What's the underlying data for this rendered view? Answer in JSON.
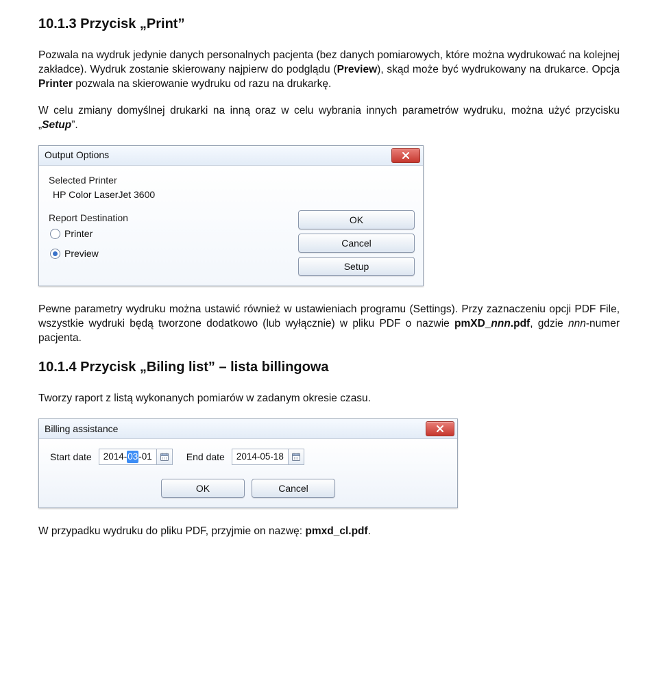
{
  "section1": {
    "heading": "10.1.3 Przycisk „Print”",
    "para1_runs": [
      {
        "text": "Pozwala na wydruk jedynie danych personalnych pacjenta (bez danych pomiarowych, które można wydrukować na kolejnej zakładce). Wydruk zostanie skierowany najpierw do podglądu ("
      },
      {
        "text": "Preview",
        "cls": "b"
      },
      {
        "text": "), skąd może być wydrukowany na drukarce. Opcja "
      },
      {
        "text": "Printer",
        "cls": "b"
      },
      {
        "text": " pozwala na skierowanie wydruku od razu na drukarkę."
      }
    ],
    "para2_runs": [
      {
        "text": "W celu zmiany domyślnej drukarki na inną oraz w celu wybrania innych parametrów wydruku, można użyć przycisku „"
      },
      {
        "text": "Setup",
        "cls": "bi"
      },
      {
        "text": "”."
      }
    ]
  },
  "dialog1": {
    "title": "Output Options",
    "selected_printer_label": "Selected Printer",
    "selected_printer_value": "HP Color LaserJet 3600",
    "dest_label": "Report Destination",
    "radio_printer": "Printer",
    "radio_preview": "Preview",
    "btn_ok": "OK",
    "btn_cancel": "Cancel",
    "btn_setup": "Setup"
  },
  "section1b": {
    "para_runs": [
      {
        "text": "Pewne parametry wydruku można ustawić również w ustawieniach programu (Settings). Przy zaznaczeniu opcji PDF File, wszystkie wydruki będą tworzone dodatkowo (lub wyłącznie) w pliku PDF o nazwie "
      },
      {
        "text": "pmXD_",
        "cls": "b"
      },
      {
        "text": "nnn",
        "cls": "bi"
      },
      {
        "text": ".pdf",
        "cls": "b"
      },
      {
        "text": ", gdzie "
      },
      {
        "text": "nnn",
        "cls": "i"
      },
      {
        "text": "-numer pacjenta."
      }
    ]
  },
  "section2": {
    "heading": "10.1.4 Przycisk „Biling list” – lista billingowa",
    "para": "Tworzy raport z listą wykonanych pomiarów w zadanym okresie czasu."
  },
  "dialog2": {
    "title": "Billing assistance",
    "start_label": "Start date",
    "start_value_pre": "2014-",
    "start_value_sel": "03",
    "start_value_post": "-01",
    "end_label": "End date",
    "end_value": "2014-05-18",
    "btn_ok": "OK",
    "btn_cancel": "Cancel"
  },
  "footer": {
    "runs": [
      {
        "text": "W przypadku wydruku do pliku PDF, przyjmie on nazwę: "
      },
      {
        "text": "pmxd_cl.pdf",
        "cls": "b"
      },
      {
        "text": "."
      }
    ]
  }
}
